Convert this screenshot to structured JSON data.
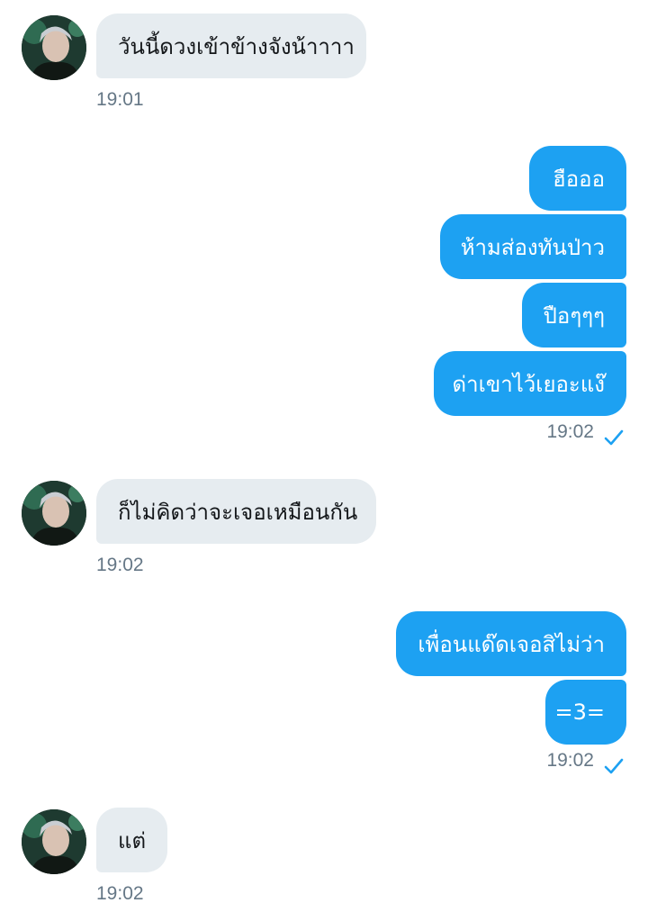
{
  "conversation": {
    "groups": [
      {
        "direction": "incoming",
        "messages": [
          "วันนี้ดวงเข้าข้างจังน้าาาา"
        ],
        "time": "19:01"
      },
      {
        "direction": "outgoing",
        "messages": [
          "ฮือออ",
          "ห้ามส่องทันป่าว",
          "ปือๆๆๆ",
          "ด่าเขาไว้เยอะแง๊"
        ],
        "time": "19:02",
        "status_icon": "check-icon"
      },
      {
        "direction": "incoming",
        "messages": [
          "ก็ไม่คิดว่าจะเจอเหมือนกัน"
        ],
        "time": "19:02"
      },
      {
        "direction": "outgoing",
        "messages": [
          "เพื่อนแด๊ดเจอสิไม่ว่า",
          "=3="
        ],
        "time": "19:02",
        "status_icon": "check-icon"
      },
      {
        "direction": "incoming",
        "messages": [
          "แต่"
        ],
        "time": "19:02"
      }
    ]
  },
  "colors": {
    "outgoing_bubble": "#1da1f2",
    "incoming_bubble": "#e6ecf0",
    "timestamp": "#657786"
  },
  "icons": {
    "avatar": "avatar",
    "read_receipt": "check-icon"
  }
}
